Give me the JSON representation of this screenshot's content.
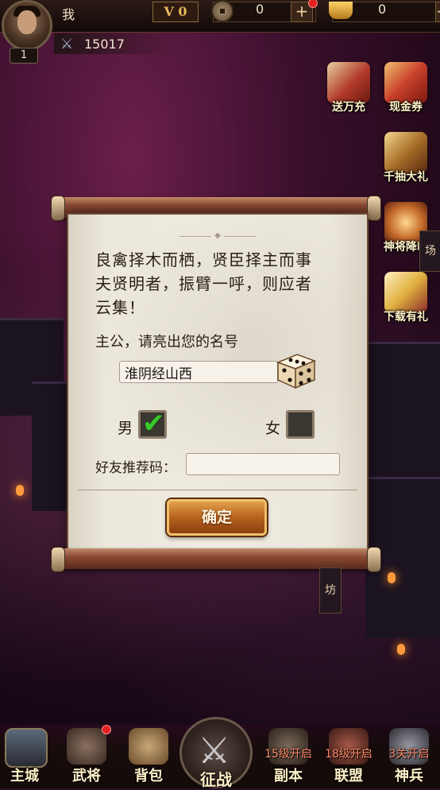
{
  "player": {
    "name": "我",
    "level": "1",
    "vip": "V 0",
    "power": "15017"
  },
  "resources": {
    "coins": "0",
    "ingots": "0"
  },
  "events": [
    {
      "label": "送万充",
      "icon": "recharge-gift-icon"
    },
    {
      "label": "现金券",
      "icon": "cash-coupon-icon"
    },
    {
      "label": "千抽大礼",
      "icon": "thousand-draw-icon"
    },
    {
      "label": "神将降临",
      "icon": "god-general-icon"
    },
    {
      "label": "下载有礼",
      "icon": "download-gift-icon"
    }
  ],
  "dialog": {
    "poem_line1": "良禽择木而栖，贤臣择主而事",
    "poem_line2": "夫贤明者，振臂一呼，则应者",
    "poem_line3": "云集！",
    "prompt": "主公，请亮出您的名号",
    "name_value": "淮阴经山西",
    "male_label": "男",
    "female_label": "女",
    "referral_label": "好友推荐码：",
    "referral_value": "",
    "confirm_label": "确定",
    "male_checked": true,
    "female_checked": false
  },
  "side_tag": "坊",
  "side_tag_top": "场",
  "bottom_nav": {
    "items": [
      {
        "label": "主城"
      },
      {
        "label": "武将"
      },
      {
        "label": "背包"
      },
      {
        "label": "征战"
      },
      {
        "label": "副本",
        "unlock": "15级开启"
      },
      {
        "label": "联盟",
        "unlock": "18级开启"
      },
      {
        "label": "神兵",
        "unlock": "3关开启"
      }
    ]
  },
  "colors": {
    "accent": "#e2a04a",
    "check": "#3ac82a",
    "notify": "#e02020"
  }
}
